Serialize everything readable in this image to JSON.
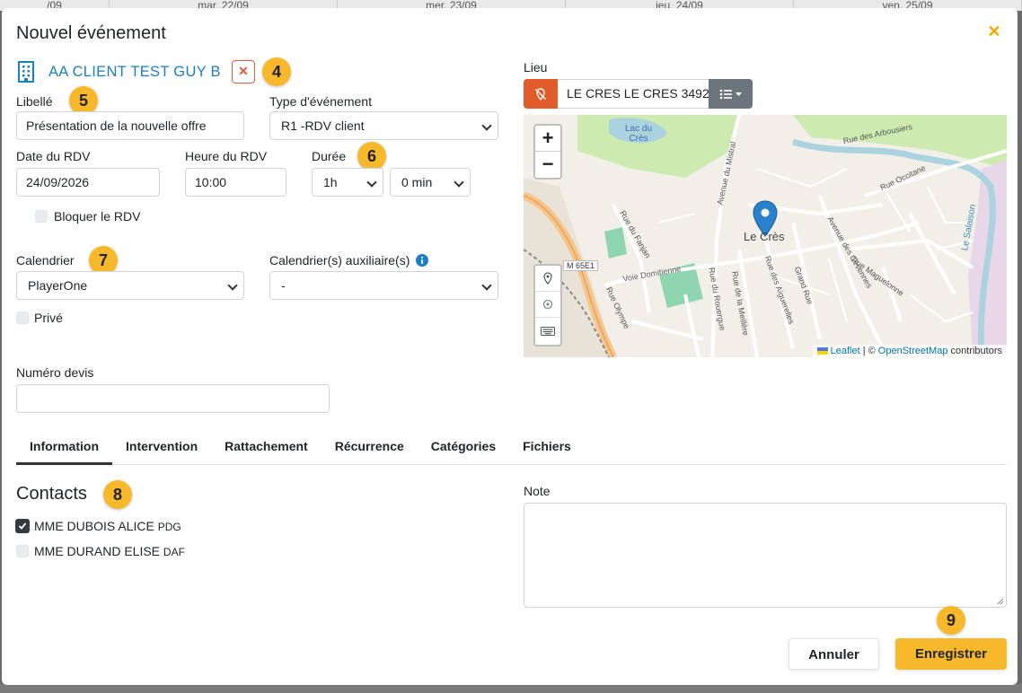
{
  "background": {
    "days": [
      "/09",
      "mar. 22/09",
      "mer. 23/09",
      "jeu. 24/09",
      "ven. 25/09"
    ]
  },
  "modal": {
    "title": "Nouvel événement",
    "client_name": "AA CLIENT TEST GUY B"
  },
  "badges": {
    "client": "4",
    "libelle": "5",
    "duree": "6",
    "calendrier": "7",
    "contacts": "8",
    "save": "9"
  },
  "form": {
    "libelle_label": "Libellé",
    "libelle_value": "Présentation de la nouvelle offre",
    "type_label": "Type d'événement",
    "type_value": "R1 -RDV client",
    "date_label": "Date du RDV",
    "date_value": "24/09/2026",
    "heure_label": "Heure du RDV",
    "heure_value": "10:00",
    "duree_label": "Durée",
    "duree_hours": "1h",
    "duree_minutes": "0 min",
    "bloquer_label": "Bloquer le RDV",
    "calendrier_label": "Calendrier",
    "calendrier_value": "PlayerOne",
    "aux_label": "Calendrier(s) auxiliaire(s)",
    "aux_value": "-",
    "prive_label": "Privé",
    "devis_label": "Numéro devis",
    "devis_value": ""
  },
  "lieu": {
    "label": "Lieu",
    "value": "LE CRES LE CRES 3492"
  },
  "map": {
    "zoom_in": "+",
    "zoom_out": "−",
    "place_label": "Le Crès",
    "lake_label": "Lac du Crès",
    "road_label": "M 65E1",
    "streets": [
      "Avenue du Mistral",
      "Rue du Fanjan",
      "Voie Domitienne",
      "Rue Olympe",
      "Rue des Arbousiers",
      "Rue Occitane",
      "Avenue des Cévennes",
      "Rue Maguelonne",
      "Grand Rue",
      "Rue des Aiguerelles",
      "Rue de la Meillère",
      "Rue du Rouergue",
      "Le Salaison"
    ],
    "attribution_leaflet": "Leaflet",
    "attribution_sep": "| ©",
    "attribution_osm": "OpenStreetMap",
    "attribution_suffix": "contributors"
  },
  "tabs": [
    "Information",
    "Intervention",
    "Rattachement",
    "Récurrence",
    "Catégories",
    "Fichiers"
  ],
  "contacts": {
    "title": "Contacts",
    "items": [
      {
        "name": "MME DUBOIS ALICE",
        "role": "PDG",
        "checked": true
      },
      {
        "name": "MME DURAND ELISE",
        "role": "DAF",
        "checked": false
      }
    ]
  },
  "note": {
    "label": "Note",
    "value": ""
  },
  "actions": {
    "cancel": "Annuler",
    "save": "Enregistrer"
  },
  "colors": {
    "accent": "#f7b92b",
    "link": "#1b7fc4",
    "danger": "#e25c2b"
  }
}
